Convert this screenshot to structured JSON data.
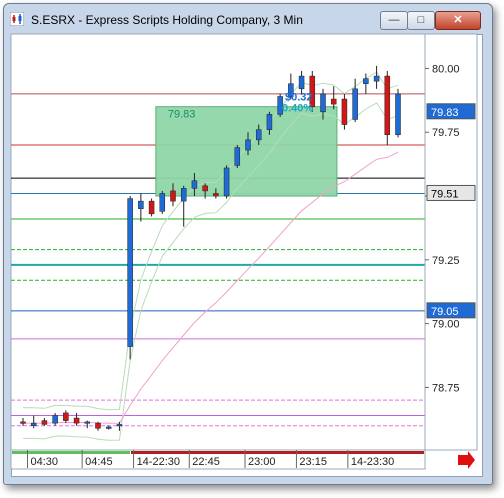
{
  "window": {
    "title": "S.ESRX - Express Scripts Holding Company, 3 Min",
    "controls": {
      "minimize": "—",
      "maximize": "□",
      "close": "✕"
    },
    "icons": {
      "app": "chart-app-icon",
      "next": "arrow-right-icon"
    }
  },
  "overlay": {
    "box_price": "79.83",
    "change": "$0.32",
    "change_pct": "0.40%",
    "box_color": "#8fd6a8"
  },
  "price_tags": [
    {
      "label": "79.83",
      "bg": "#1e6bd6",
      "fg": "#ffffff"
    },
    {
      "label": "79.51",
      "bg": "#e6e6e6",
      "fg": "#000000"
    },
    {
      "label": "79.05",
      "bg": "#1e6bd6",
      "fg": "#ffffff"
    }
  ],
  "chart_data": {
    "type": "candlestick",
    "title": "S.ESRX - Express Scripts Holding Company, 3 Min",
    "interval": "3 Min",
    "ylim": [
      78.54,
      80.08
    ],
    "y_ticks": [
      "80.00",
      "79.75",
      "79.50",
      "79.25",
      "79.00",
      "78.75"
    ],
    "x_ticks": [
      "04:30",
      "04:45",
      "14-22:30",
      "22:45",
      "23:00",
      "23:15",
      "14-23:30"
    ],
    "levels": [
      {
        "price": 79.9,
        "color": "#b05050"
      },
      {
        "price": 79.7,
        "color": "#c83030"
      },
      {
        "price": 79.57,
        "color": "#000000"
      },
      {
        "price": 79.51,
        "color": "#2a7aa8"
      },
      {
        "price": 79.41,
        "color": "#22b022"
      },
      {
        "price": 79.29,
        "color": "#22b022",
        "dash": true
      },
      {
        "price": 79.23,
        "color": "#20a8a8"
      },
      {
        "price": 79.17,
        "color": "#22b022",
        "dash": true
      },
      {
        "price": 79.05,
        "color": "#2060c0"
      },
      {
        "price": 78.94,
        "color": "#d070d0"
      },
      {
        "price": 78.7,
        "color": "#e070e0",
        "dash": true
      },
      {
        "price": 78.64,
        "color": "#c060e0"
      },
      {
        "price": 78.6,
        "color": "#e070e0",
        "dash": true
      }
    ],
    "candles": [
      {
        "o": 78.615,
        "h": 78.63,
        "l": 78.6,
        "c": 78.61
      },
      {
        "o": 78.6,
        "h": 78.64,
        "l": 78.59,
        "c": 78.61
      },
      {
        "o": 78.62,
        "h": 78.63,
        "l": 78.6,
        "c": 78.605
      },
      {
        "o": 78.61,
        "h": 78.65,
        "l": 78.6,
        "c": 78.64
      },
      {
        "o": 78.65,
        "h": 78.66,
        "l": 78.61,
        "c": 78.62
      },
      {
        "o": 78.63,
        "h": 78.65,
        "l": 78.6,
        "c": 78.61
      },
      {
        "o": 78.61,
        "h": 78.62,
        "l": 78.59,
        "c": 78.615
      },
      {
        "o": 78.61,
        "h": 78.615,
        "l": 78.58,
        "c": 78.59
      },
      {
        "o": 78.59,
        "h": 78.6,
        "l": 78.585,
        "c": 78.595
      },
      {
        "o": 78.6,
        "h": 78.615,
        "l": 78.58,
        "c": 78.605
      },
      {
        "o": 78.91,
        "h": 79.5,
        "l": 78.86,
        "c": 79.49
      },
      {
        "o": 79.45,
        "h": 79.51,
        "l": 79.4,
        "c": 79.48
      },
      {
        "o": 79.48,
        "h": 79.49,
        "l": 79.42,
        "c": 79.43
      },
      {
        "o": 79.44,
        "h": 79.52,
        "l": 79.43,
        "c": 79.51
      },
      {
        "o": 79.52,
        "h": 79.55,
        "l": 79.46,
        "c": 79.48
      },
      {
        "o": 79.48,
        "h": 79.54,
        "l": 79.38,
        "c": 79.53
      },
      {
        "o": 79.53,
        "h": 79.59,
        "l": 79.5,
        "c": 79.56
      },
      {
        "o": 79.54,
        "h": 79.55,
        "l": 79.49,
        "c": 79.52
      },
      {
        "o": 79.51,
        "h": 79.53,
        "l": 79.49,
        "c": 79.5
      },
      {
        "o": 79.5,
        "h": 79.62,
        "l": 79.49,
        "c": 79.61
      },
      {
        "o": 79.62,
        "h": 79.7,
        "l": 79.61,
        "c": 79.69
      },
      {
        "o": 79.68,
        "h": 79.75,
        "l": 79.66,
        "c": 79.72
      },
      {
        "o": 79.72,
        "h": 79.78,
        "l": 79.7,
        "c": 79.76
      },
      {
        "o": 79.76,
        "h": 79.83,
        "l": 79.74,
        "c": 79.82
      },
      {
        "o": 79.82,
        "h": 79.9,
        "l": 79.81,
        "c": 79.89
      },
      {
        "o": 79.89,
        "h": 79.98,
        "l": 79.88,
        "c": 79.94
      },
      {
        "o": 79.92,
        "h": 79.99,
        "l": 79.9,
        "c": 79.97
      },
      {
        "o": 79.97,
        "h": 79.99,
        "l": 79.83,
        "c": 79.85
      },
      {
        "o": 79.83,
        "h": 79.92,
        "l": 79.8,
        "c": 79.9
      },
      {
        "o": 79.88,
        "h": 79.93,
        "l": 79.84,
        "c": 79.86
      },
      {
        "o": 79.88,
        "h": 79.9,
        "l": 79.76,
        "c": 79.78
      },
      {
        "o": 79.8,
        "h": 79.96,
        "l": 79.79,
        "c": 79.92
      },
      {
        "o": 79.94,
        "h": 79.98,
        "l": 79.9,
        "c": 79.96
      },
      {
        "o": 79.95,
        "h": 80.01,
        "l": 79.92,
        "c": 79.97
      },
      {
        "o": 79.97,
        "h": 79.99,
        "l": 79.7,
        "c": 79.74
      },
      {
        "o": 79.74,
        "h": 79.92,
        "l": 79.73,
        "c": 79.9
      }
    ]
  }
}
